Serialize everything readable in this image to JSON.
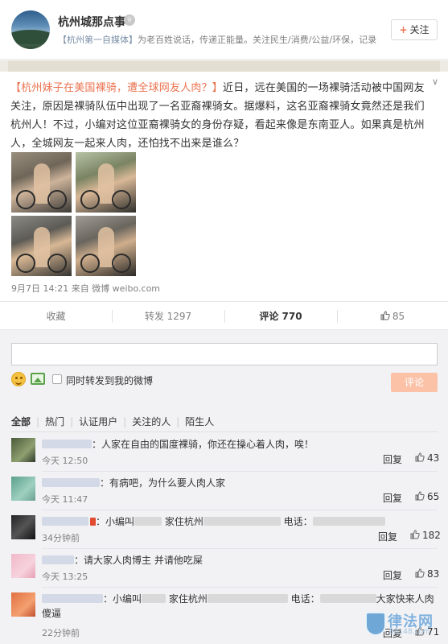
{
  "header": {
    "name": "杭州城那点事",
    "desc_tag": "【杭州第一自媒体】",
    "desc_rest": "为老百姓说话，传递正能量。关注民生/消费/公益/环保，记录",
    "follow_label": "关注",
    "follow_icon": "plus-icon"
  },
  "post": {
    "text_tag": "【杭州妹子在美国裸骑，遭全球网友人肉？】",
    "text_body": "近日，远在美国的一场裸骑活动被中国网友关注，原因是裸骑队伍中出现了一名亚裔裸骑女。据爆料，这名亚裔裸骑女竟然还是我们杭州人！不过，小编对这位亚裔裸骑女的身份存疑，看起来像是东南亚人。如果真是杭州人，全城网友一起来人肉，还怕找不出来是谁么？",
    "meta": "9月7日 14:21 来自 微博 weibo.com",
    "photo_count": 4
  },
  "actions": {
    "collect": "收藏",
    "repost": "转发 1297",
    "comment": "评论 770",
    "like": "85"
  },
  "composer": {
    "placeholder": "",
    "sync_label": "同时转发到我的微博",
    "submit_label": "评论"
  },
  "filters": [
    "全部",
    "热门",
    "认证用户",
    "关注的人",
    "陌生人"
  ],
  "comments": [
    {
      "text": "：人家在自由的国度裸骑，你还在操心着人肉，唉！",
      "time": "今天 12:50",
      "reply": "回复",
      "likes": "43"
    },
    {
      "text": "：有病吧，为什么要人肉人家",
      "time": "今天 11:47",
      "reply": "回复",
      "likes": "65"
    },
    {
      "text_a": "：小编叫",
      "text_b": " 家住杭州",
      "text_c": " 电话：",
      "time": "34分钟前",
      "reply": "回复",
      "likes": "182"
    },
    {
      "text": "：请大家人肉博主 并请他吃屎",
      "time": "今天 13:25",
      "reply": "回复",
      "likes": "83"
    },
    {
      "text_a": "：小编叫",
      "text_b": " 家住杭州",
      "text_c": " 电话：",
      "text_d": "大家快来人肉傻逼",
      "time": "22分钟前",
      "reply": "回复",
      "likes": "71"
    }
  ],
  "watermark": {
    "text": "律法网",
    "sub": "88148.com"
  }
}
